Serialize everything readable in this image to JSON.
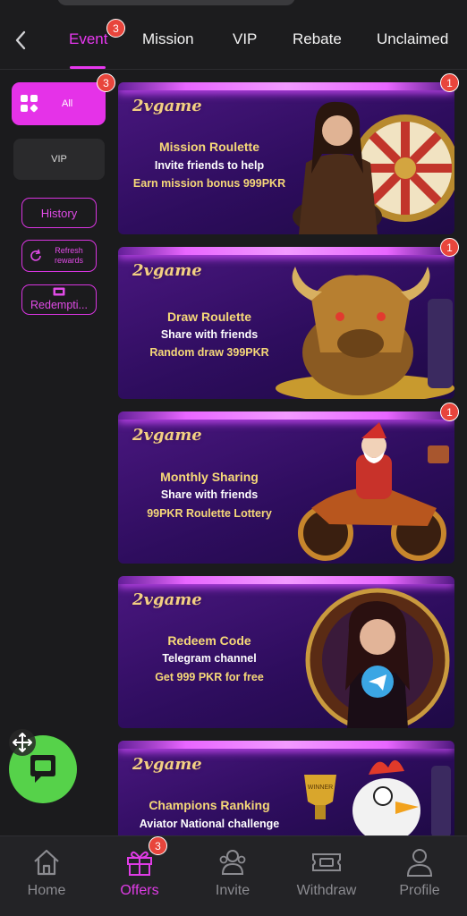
{
  "header": {
    "tabs": [
      {
        "label": "Event",
        "active": true,
        "badge": "3"
      },
      {
        "label": "Mission"
      },
      {
        "label": "VIP"
      },
      {
        "label": "Rebate"
      },
      {
        "label": "Unclaimed"
      }
    ]
  },
  "sidebar": {
    "all": {
      "label": "All",
      "badge": "3"
    },
    "vip": {
      "label": "VIP"
    },
    "history": "History",
    "refresh": "Refresh rewards",
    "redemption": "Redempti..."
  },
  "cards": [
    {
      "logo": "2vgame",
      "badge": "1",
      "title": "Mission Roulette",
      "line1": "Invite friends to help",
      "line2": "Earn mission bonus 999PKR"
    },
    {
      "logo": "2vgame",
      "badge": "1",
      "title": "Draw Roulette",
      "line1": "Share with friends",
      "line2": "Random draw 399PKR"
    },
    {
      "logo": "2vgame",
      "badge": "1",
      "title": "Monthly Sharing",
      "line1": "Share with friends",
      "line2": "99PKR Roulette Lottery"
    },
    {
      "logo": "2vgame",
      "title": "Redeem Code",
      "line1": "Telegram channel",
      "line2": "Get 999 PKR for free"
    },
    {
      "logo": "2vgame",
      "title": "Champions Ranking",
      "line1": "Aviator National challenge",
      "art_text": "WINNER"
    }
  ],
  "bottom_nav": [
    {
      "label": "Home",
      "icon": "home-icon"
    },
    {
      "label": "Offers",
      "icon": "gift-icon",
      "active": true,
      "badge": "3"
    },
    {
      "label": "Invite",
      "icon": "users-icon"
    },
    {
      "label": "Withdraw",
      "icon": "ticket-icon"
    },
    {
      "label": "Profile",
      "icon": "person-icon"
    }
  ],
  "colors": {
    "accent": "#e532e8",
    "badge": "#e8453c",
    "chat": "#56d24a",
    "gold_text": "#f6d878"
  }
}
